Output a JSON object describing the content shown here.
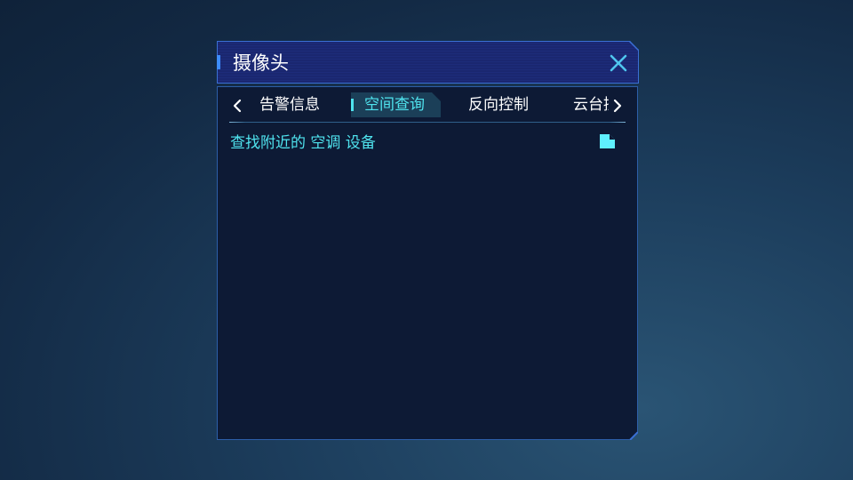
{
  "panel": {
    "title": "摄像头",
    "close_icon": "close-icon"
  },
  "tabs": [
    {
      "label": "告警信息",
      "active": false
    },
    {
      "label": "空间查询",
      "active": true
    },
    {
      "label": "反向控制",
      "active": false
    },
    {
      "label": "云台控制",
      "active": false
    }
  ],
  "tab_nav": {
    "prev_icon": "chevron-left-icon",
    "next_icon": "chevron-right-icon"
  },
  "content": {
    "query_label": "查找附近的 空调 设备",
    "action_icon": "document-icon"
  },
  "colors": {
    "accent_cyan": "#4fe3ee",
    "header_bg": "#1a2770",
    "header_border": "#3a6fd4",
    "body_bg": "#0d1a35",
    "body_border": "#2c5ea8",
    "active_tab_bg": "#1b3f58",
    "text": "#ffffff"
  }
}
